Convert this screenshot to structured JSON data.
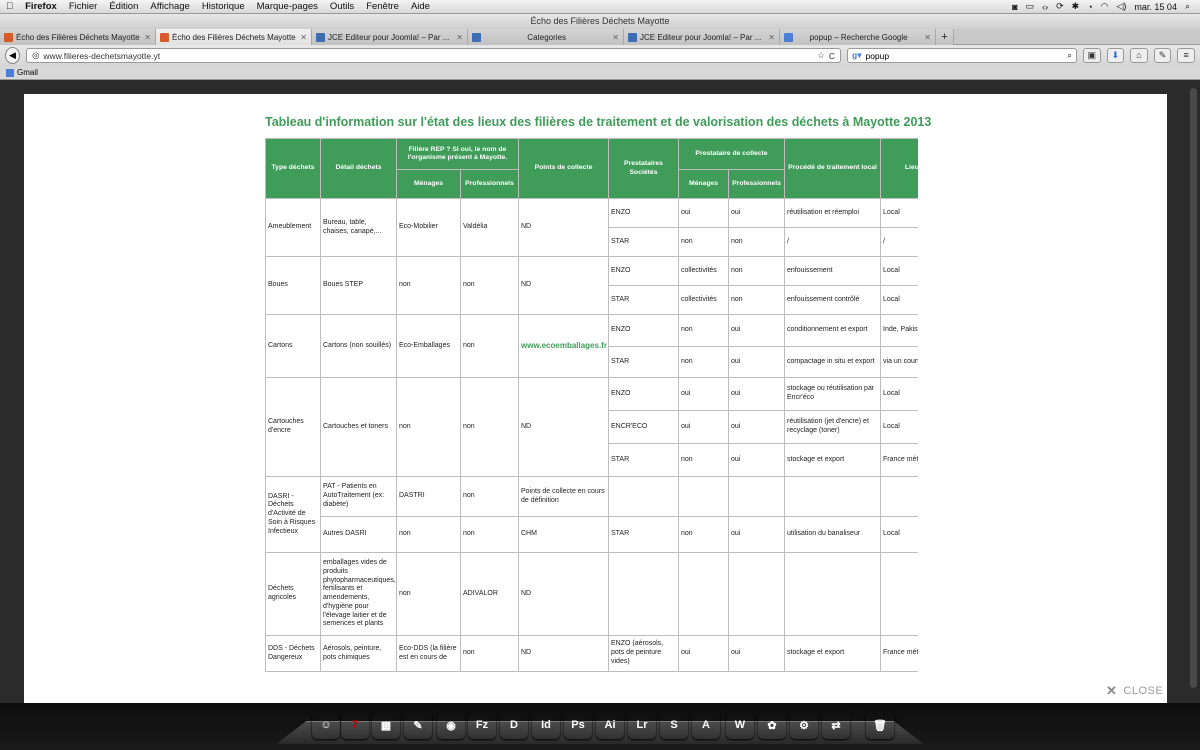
{
  "menubar": {
    "app": "Firefox",
    "items": [
      "Fichier",
      "Édition",
      "Affichage",
      "Historique",
      "Marque-pages",
      "Outils",
      "Fenêtre",
      "Aide"
    ],
    "clock": "mar. 15 04"
  },
  "window_title": "Écho des Filières Déchets Mayotte",
  "tabs": [
    {
      "label": "Écho des Filières Déchets Mayotte",
      "color": "#d85a2a",
      "active": false
    },
    {
      "label": "Écho des Filières Déchets Mayotte",
      "color": "#d85a2a",
      "active": true
    },
    {
      "label": "JCE Editeur pour Joomla! – Par ...",
      "color": "#3b6db0",
      "active": false
    },
    {
      "label": "Categories",
      "color": "#3b6db0",
      "active": false
    },
    {
      "label": "JCE Editeur pour Joomla! – Par ...",
      "color": "#3b6db0",
      "active": false
    },
    {
      "label": "popup – Recherche Google",
      "color": "#4a7fd4",
      "active": false
    }
  ],
  "nav": {
    "url": "www.filieres-dechetsmayotte.yt",
    "search": "popup",
    "back": "◀",
    "reload": "C",
    "star": "☆"
  },
  "bookmarks": [
    {
      "label": "Gmail"
    }
  ],
  "lightbox": {
    "title": "Tableau d'information sur l'état des lieux des filières de traitement et de valorisation des déchets à Mayotte 2013",
    "close": "CLOSE",
    "headers": {
      "type": "Type déchets",
      "detail": "Détail déchets",
      "rep": "Filière REP ? Si oui, le nom de l'organisme présent à Mayotte.",
      "menages": "Ménages",
      "pros": "Professionnels",
      "collecte": "Points de collecte",
      "prest": "Prestataires Sociétés",
      "prest_col": "Prestataire de collecte",
      "menages2": "Ménages",
      "pros2": "Professionnels",
      "proc": "Procédé de traitement local",
      "lieu": "Lieu du tr..."
    },
    "rows": [
      {
        "type": "Ameublement",
        "detail": "Bureau, table, chaises, canapé,...",
        "men": "Eco-Mobilier",
        "pro": "Valdélia",
        "col": "ND",
        "subs": [
          [
            "ENZO",
            "oui",
            "oui",
            "réutilisation et réemploi",
            "Local"
          ],
          [
            "STAR",
            "non",
            "non",
            "/",
            "/"
          ]
        ]
      },
      {
        "type": "Boues",
        "detail": "Boues STEP",
        "men": "non",
        "pro": "non",
        "col": "ND",
        "subs": [
          [
            "ENZO",
            "collectivités",
            "non",
            "enfouissement",
            "Local"
          ],
          [
            "STAR",
            "collectivités",
            "non",
            "enfouissement contrôlé",
            "Local"
          ]
        ]
      },
      {
        "type": "Cartons",
        "detail": "Cartons (non souillés)",
        "men": "Eco-Emballages",
        "pro": "non",
        "col": "www.ecoemballages.fr",
        "subs": [
          [
            "ENZO",
            "non",
            "oui",
            "conditionnement et export",
            "Inde, Pakistan, Malésie"
          ],
          [
            "STAR",
            "non",
            "oui",
            "compactage in situ et export",
            "via un courtier de négoce"
          ]
        ]
      },
      {
        "type": "Cartouches d'encre",
        "detail": "Cartouches et toners",
        "men": "non",
        "pro": "non",
        "col": "ND",
        "subs": [
          [
            "ENZO",
            "oui",
            "oui",
            "stockage ou réutilisation par Encr'éco",
            "Local"
          ],
          [
            "ENCR'ECO",
            "oui",
            "oui",
            "réutilisation (jet d'encre) et recyclage (toner)",
            "Local"
          ],
          [
            "STAR",
            "non",
            "oui",
            "stockage et export",
            "France métropole"
          ]
        ]
      },
      {
        "type": "DASRI - Déchets d'Activité de Soin à Risques Infectieux",
        "subrows": [
          {
            "detail": "PAT - Patients en AutoTraitement (ex: diabète)",
            "men": "DASTRI",
            "pro": "non",
            "col": "Points de collecte en cours de définition",
            "sub": [
              "",
              "",
              "",
              "",
              ""
            ]
          },
          {
            "detail": "Autres DASRI",
            "men": "non",
            "pro": "non",
            "col": "CHM",
            "sub": [
              "STAR",
              "non",
              "oui",
              "utilisation du banaliseur",
              "Local"
            ]
          }
        ]
      },
      {
        "type": "Déchets agricoles",
        "detail": "emballages vides de produits phytopharmaceutiques, fertilisants et amendements, d'hygiène pour l'élevage laitier et de semences et plants",
        "men": "non",
        "pro": "ADIVALOR",
        "col": "ND",
        "sub": [
          "",
          "",
          "",
          "",
          ""
        ]
      },
      {
        "type": "DDS - Déchets Dangereux",
        "detail": "Aérosols, peinture, pots chimiques",
        "men": "Eco-DDS (la filière est en cours de",
        "pro": "non",
        "col": "ND",
        "sub": [
          "ENZO (aérosols, pots de peinture vides)",
          "oui",
          "oui",
          "stockage et export",
          "France métropole"
        ]
      }
    ]
  },
  "dock": [
    {
      "label": "☺",
      "color": "#4a78c2"
    },
    {
      "label": "7",
      "color": "#e8e8e8"
    },
    {
      "label": "▦",
      "color": "#777"
    },
    {
      "label": "✎",
      "color": "#5d7fb0"
    },
    {
      "label": "◉",
      "color": "#e06a1b"
    },
    {
      "label": "Fz",
      "color": "#b8191f"
    },
    {
      "label": "D",
      "color": "#c6a13a"
    },
    {
      "label": "Id",
      "color": "#6b1a4c"
    },
    {
      "label": "Ps",
      "color": "#102a4a"
    },
    {
      "label": "Ai",
      "color": "#4a2a0c"
    },
    {
      "label": "Lr",
      "color": "#2e3440"
    },
    {
      "label": "S",
      "color": "#24a5e0"
    },
    {
      "label": "A",
      "color": "#b8191f"
    },
    {
      "label": "W",
      "color": "#4ca8c6"
    },
    {
      "label": "✿",
      "color": "#4a9a3a"
    },
    {
      "label": "⚙",
      "color": "#999"
    },
    {
      "label": "⇄",
      "color": "#1d7fd0"
    },
    {
      "label": "🗑",
      "color": "#555"
    }
  ]
}
